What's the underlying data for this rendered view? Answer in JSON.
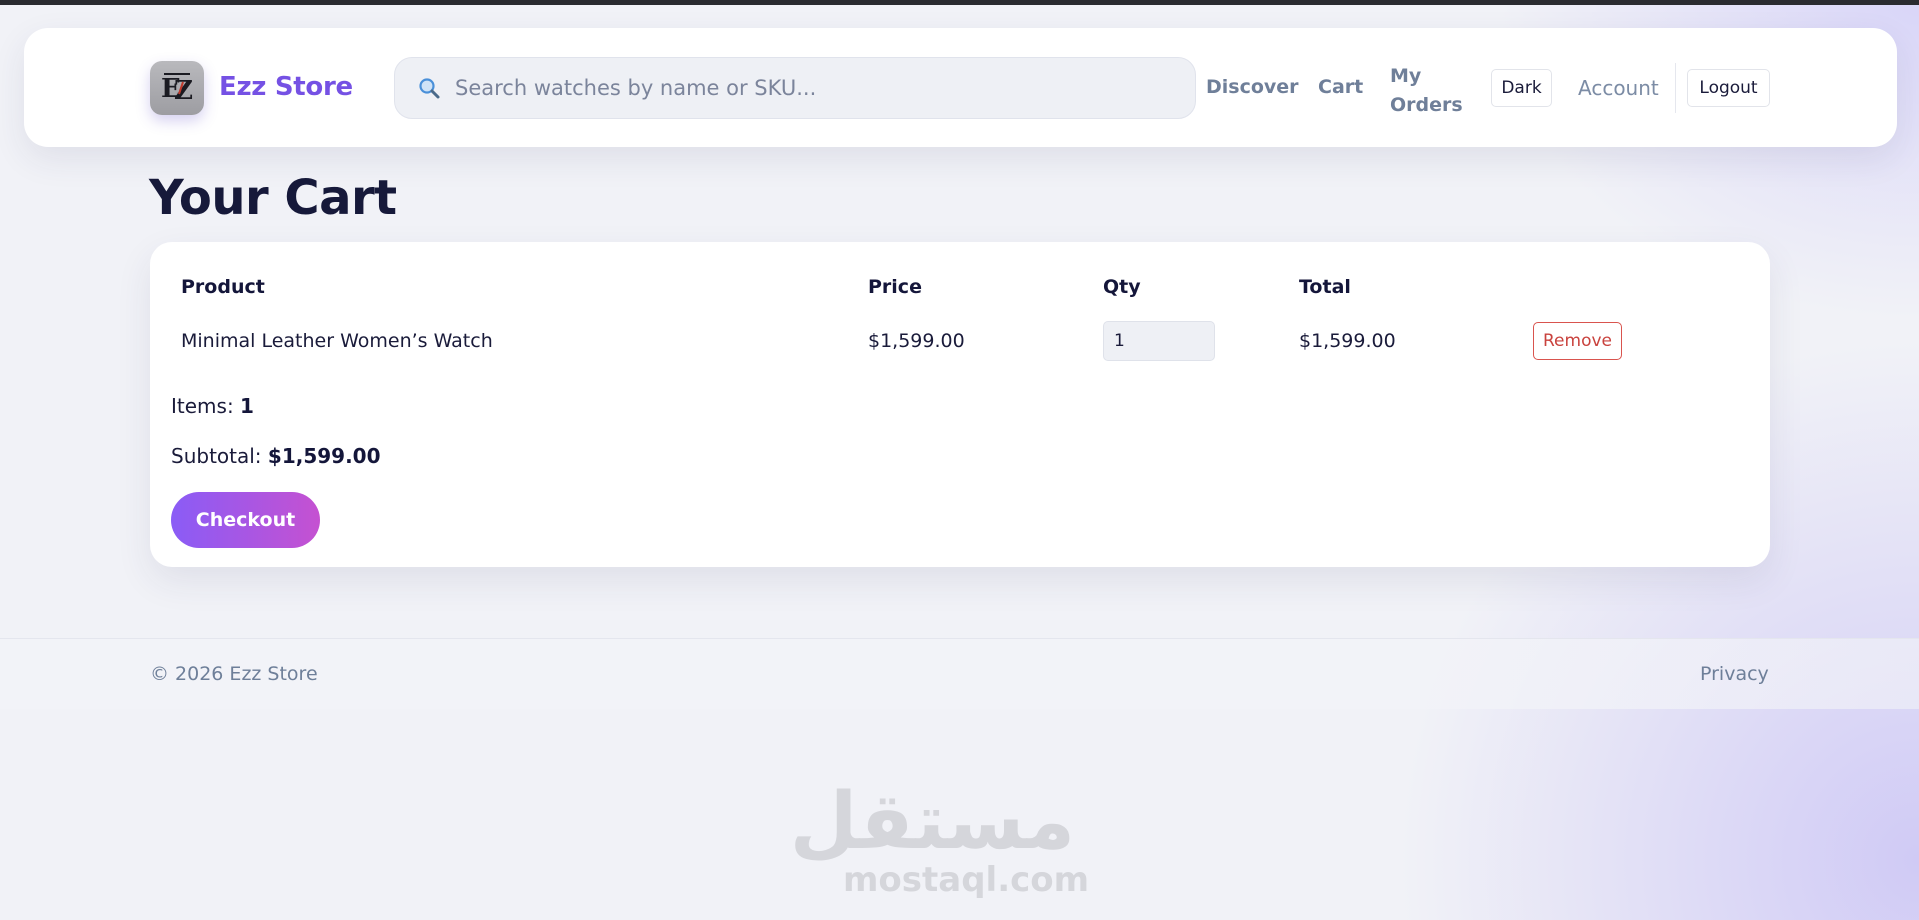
{
  "brand": {
    "name": "Ezz Store",
    "logo_text": "EZ"
  },
  "search": {
    "placeholder": "Search watches by name or SKU..."
  },
  "nav": {
    "discover": "Discover",
    "cart": "Cart",
    "orders": "My Orders",
    "theme_toggle": "Dark",
    "account": "Account",
    "logout": "Logout"
  },
  "page": {
    "title": "Your Cart"
  },
  "cart": {
    "columns": {
      "product": "Product",
      "price": "Price",
      "qty": "Qty",
      "total": "Total"
    },
    "rows": [
      {
        "product": "Minimal Leather Women’s Watch",
        "price": "$1,599.00",
        "qty": "1",
        "total": "$1,599.00",
        "remove_label": "Remove"
      }
    ],
    "items_label": "Items:",
    "items_count": "1",
    "subtotal_label": "Subtotal:",
    "subtotal_value": "$1,599.00",
    "checkout_label": "Checkout"
  },
  "footer": {
    "copyright": "© 2026 Ezz Store",
    "privacy": "Privacy"
  },
  "watermark": {
    "arabic": "مستقل",
    "latin": "mostaql.com"
  },
  "colors": {
    "accent": "#7551e4",
    "danger": "#c9423d",
    "checkout_start": "#8a5cf6",
    "checkout_end": "#c551d1"
  }
}
